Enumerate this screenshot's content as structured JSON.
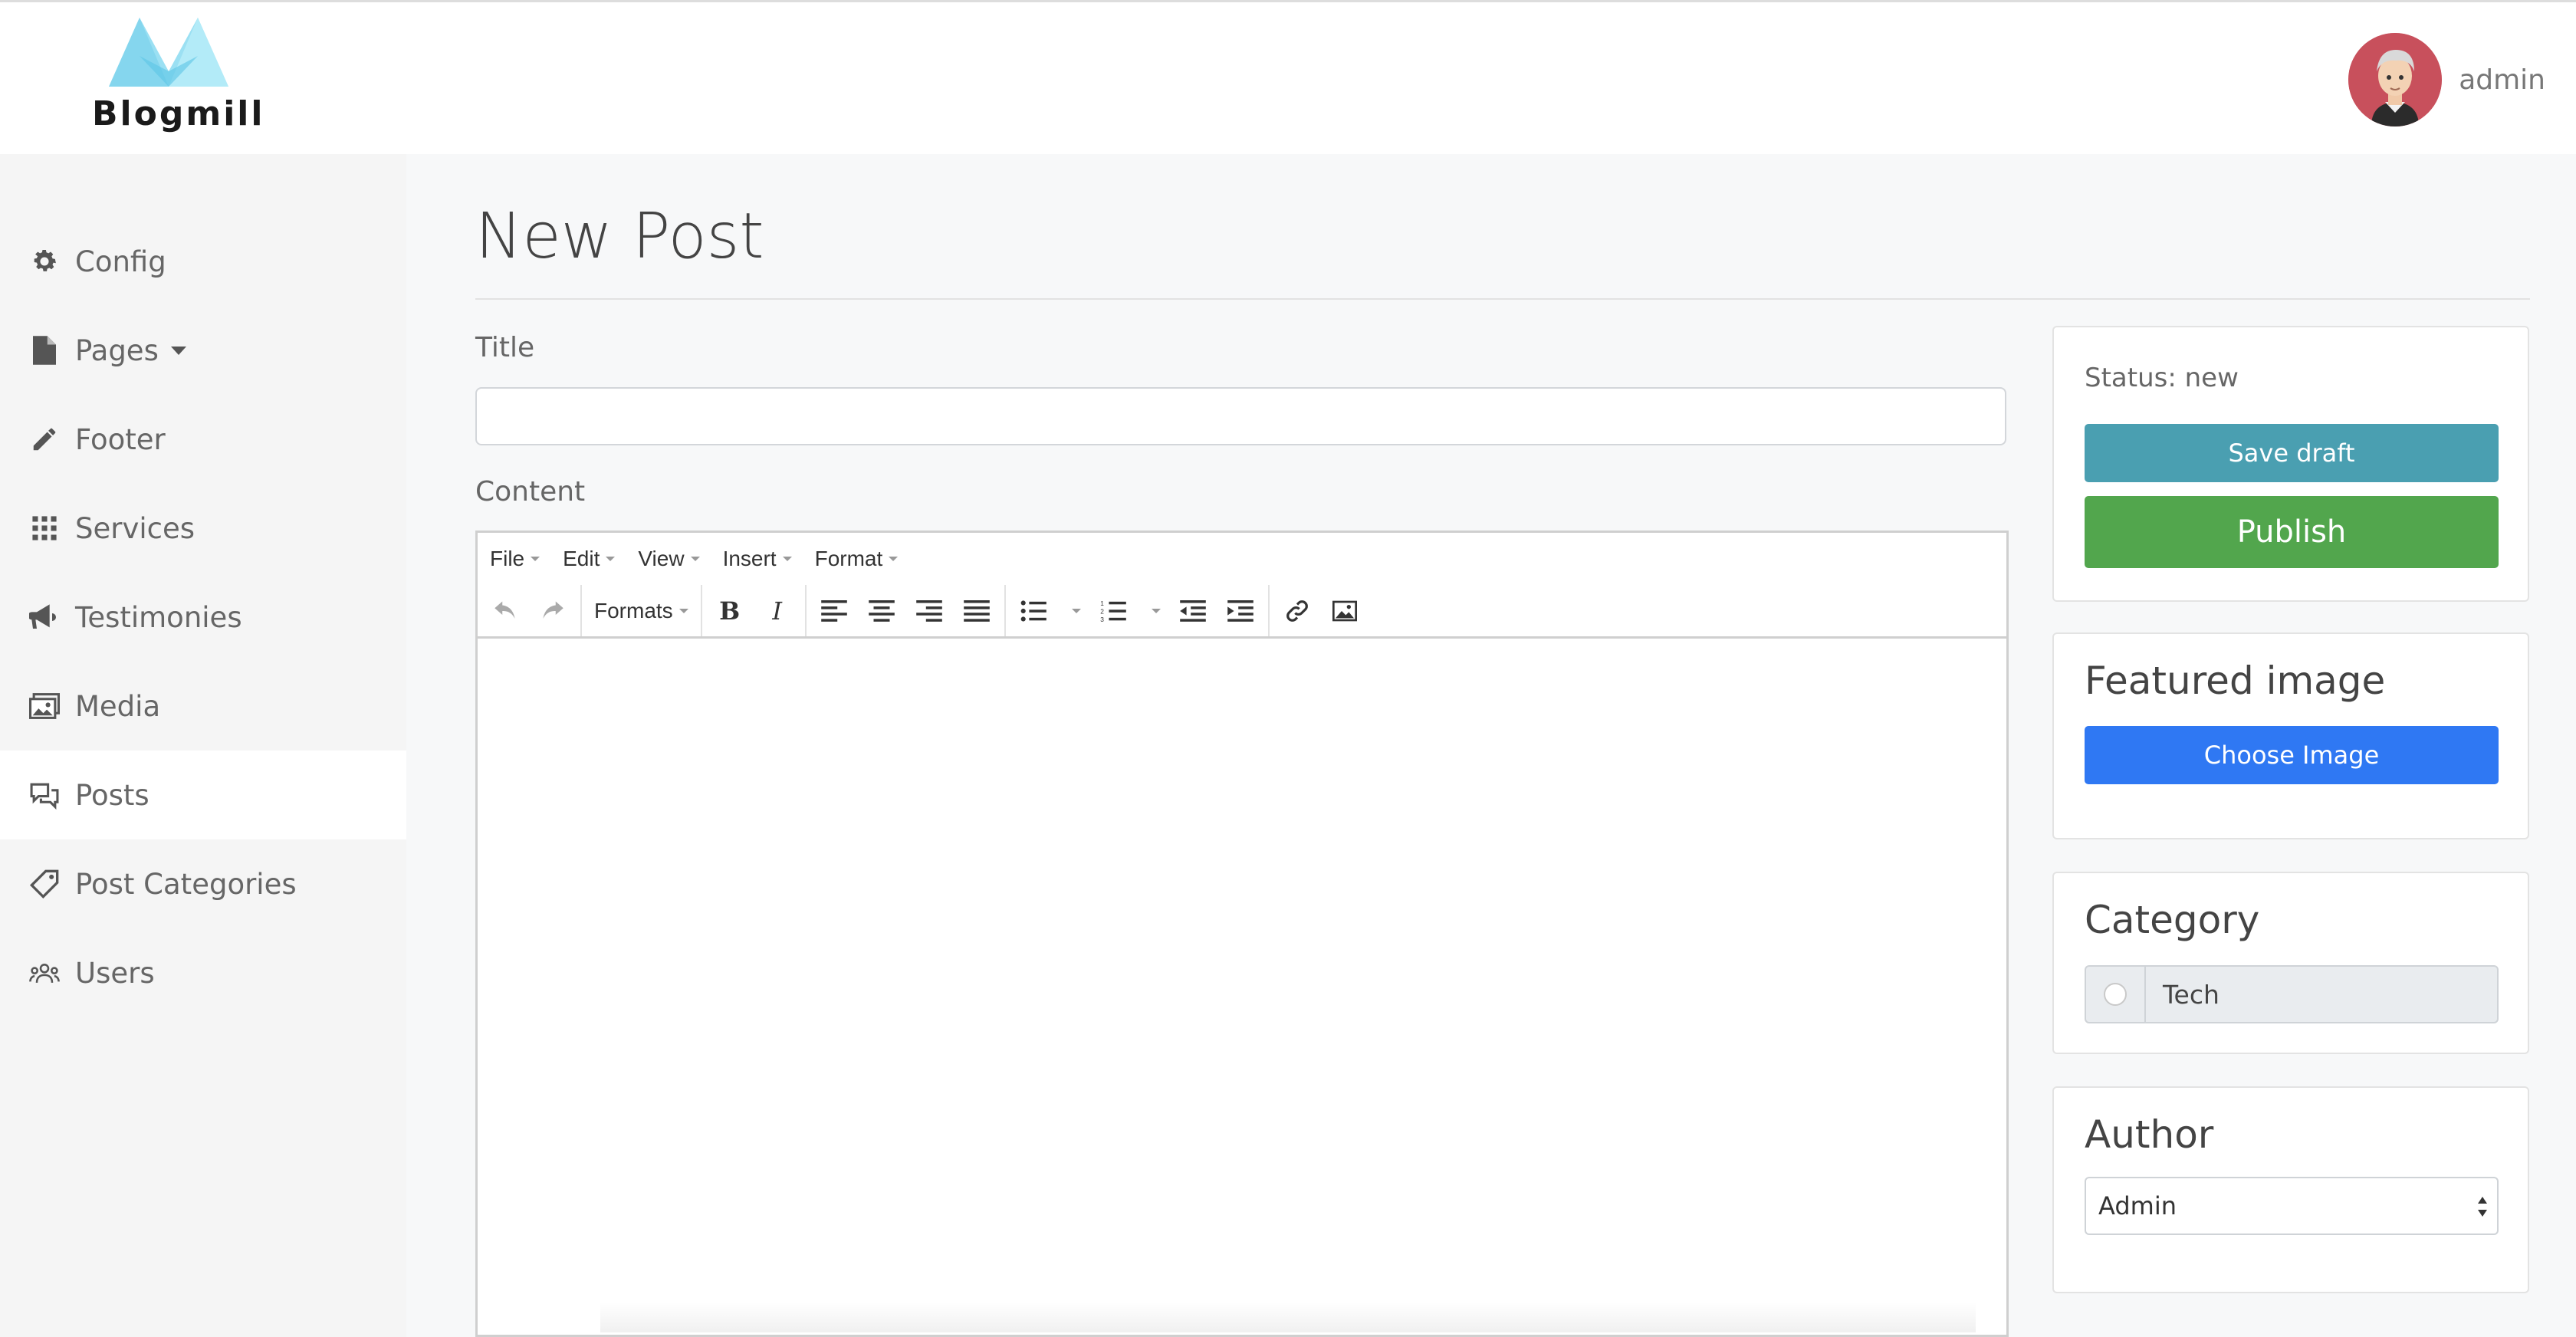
{
  "app": {
    "name": "Blogmill"
  },
  "header": {
    "user_name": "admin"
  },
  "sidebar": {
    "items": [
      {
        "label": "Config",
        "icon": "gear-icon"
      },
      {
        "label": "Pages",
        "icon": "file-icon"
      },
      {
        "label": "Footer",
        "icon": "pencil-icon"
      },
      {
        "label": "Services",
        "icon": "grid-icon"
      },
      {
        "label": "Testimonies",
        "icon": "megaphone-icon"
      },
      {
        "label": "Media",
        "icon": "images-icon"
      },
      {
        "label": "Posts",
        "icon": "comments-icon",
        "active": true
      },
      {
        "label": "Post Categories",
        "icon": "tag-icon"
      },
      {
        "label": "Users",
        "icon": "users-icon"
      }
    ]
  },
  "main": {
    "title": "New Post",
    "title_label": "Title",
    "title_value": "",
    "content_label": "Content"
  },
  "editor": {
    "menus": [
      "File",
      "Edit",
      "View",
      "Insert",
      "Format"
    ],
    "formats_label": "Formats"
  },
  "status_card": {
    "status": "Status: new",
    "save_draft": "Save draft",
    "publish": "Publish"
  },
  "featured_card": {
    "title": "Featured image",
    "choose": "Choose Image"
  },
  "category_card": {
    "title": "Category",
    "options": [
      "Tech"
    ]
  },
  "author_card": {
    "title": "Author",
    "selected": "Admin"
  },
  "colors": {
    "save_draft": "#4a9fb1",
    "publish": "#52a64d",
    "choose_image": "#2f78f3",
    "logo": "#7fd3ec"
  }
}
